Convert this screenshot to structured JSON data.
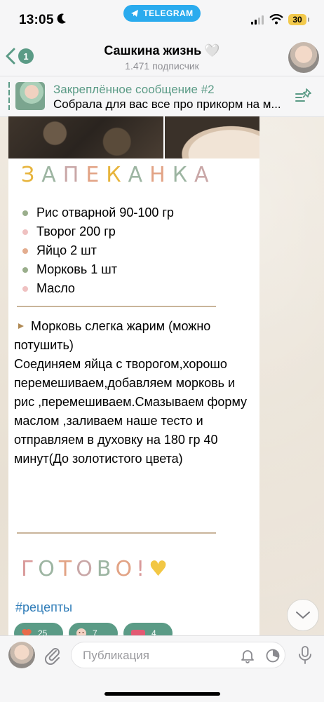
{
  "status_bar": {
    "time": "13:05",
    "telegram_label": "TELEGRAM",
    "battery": "30"
  },
  "header": {
    "back_badge": "1",
    "channel_title": "Сашкина жизнь",
    "title_emoji": "🤍",
    "subscribers": "1.471 подписчик"
  },
  "pinned": {
    "title": "Закреплённое сообщение #2",
    "text": "Собрала для вас все про прикорм на м..."
  },
  "message": {
    "heading_letters": [
      "З",
      "А",
      "П",
      "Е",
      "К",
      "А",
      "Н",
      "К",
      "А"
    ],
    "heading_colors": [
      "#e7b43c",
      "#9db5a2",
      "#c9a7a7",
      "#e2a385",
      "#e7b43c",
      "#9db5a2",
      "#e2a385",
      "#9db5a2",
      "#c9a7a7"
    ],
    "ingredients": [
      {
        "text": "Рис отварной 90-100 гр",
        "dot_color": "#9aae8c"
      },
      {
        "text": "Творог 200 гр",
        "dot_color": "#efc1c1"
      },
      {
        "text": "Яйцо 2 шт",
        "dot_color": "#e3ad8f"
      },
      {
        "text": "Морковь 1 шт",
        "dot_color": "#9aae8c"
      },
      {
        "text": "Масло",
        "dot_color": "#efc1c1"
      }
    ],
    "instruction_first": "Морковь слегка жарим (можно потушить)",
    "instruction_rest": "Соединяем яйца с творогом,хорошо перемешиваем,добавляем морковь и рис ,перемешиваем.Смазываем форму маслом ,заливаем наше тесто и отправляем в духовку на 180 гр 40 минут(До золотистого цвета)",
    "done_letters": [
      "Г",
      "О",
      "Т",
      "О",
      "В",
      "О",
      "!"
    ],
    "done_colors": [
      "#d99a9a",
      "#9db5a2",
      "#e2a385",
      "#c9a7a7",
      "#9db5a2",
      "#e2a385",
      "#d99a9a"
    ],
    "done_heart": "♥",
    "hashtag": "#рецепты",
    "reactions": [
      {
        "emoji": "heart-reaction",
        "count": "25"
      },
      {
        "emoji": "face-reaction",
        "count": "7"
      },
      {
        "emoji": "nom-reaction",
        "count": "4"
      }
    ]
  },
  "input": {
    "placeholder": "Публикация"
  },
  "colors": {
    "accent": "#5b9b86",
    "link": "#2e7cb8",
    "telegram": "#2aabee"
  }
}
